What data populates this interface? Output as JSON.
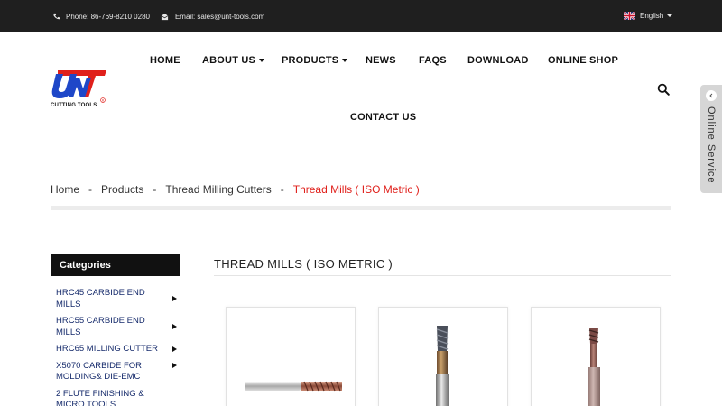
{
  "topbar": {
    "phone": "Phone: 86-769-8210 0280",
    "email": "Email: sales@unt-tools.com",
    "language": "English"
  },
  "logo": {
    "text": "UNT",
    "subtitle": "CUTTING TOOLS"
  },
  "nav": {
    "home": "HOME",
    "about": "ABOUT US",
    "products": "PRODUCTS",
    "news": "NEWS",
    "faqs": "FAQS",
    "download": "DOWNLOAD",
    "shop": "ONLINE SHOP",
    "contact": "CONTACT US"
  },
  "online_service": "Online Service",
  "breadcrumb": {
    "items": [
      "Home",
      "Products",
      "Thread Milling Cutters",
      "Thread Mills ( ISO Metric )"
    ],
    "separator": "-"
  },
  "sidebar": {
    "title": "Categories",
    "items": [
      "HRC45 CARBIDE END MILLS",
      "HRC55 CARBIDE END MILLS",
      "HRC65 MILLING CUTTER",
      "X5070 CARBIDE FOR MOLDING& DIE-EMC",
      "2 FLUTE FINISHING & MICRO TOOLS"
    ]
  },
  "main": {
    "title": "THREAD MILLS ( ISO METRIC )"
  },
  "colors": {
    "topbar_bg": "#1f1f1f",
    "accent_red": "#e0201b",
    "logo_blue": "#1e47c8",
    "category_link": "#152a6b"
  }
}
